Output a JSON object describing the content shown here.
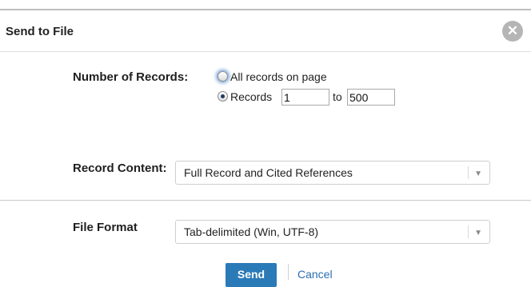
{
  "dialog": {
    "title": "Send to File",
    "close_icon": "close-icon",
    "number_of_records": {
      "label": "Number of Records:",
      "option_all": "All records on page",
      "option_range": "Records",
      "to_label": "to",
      "from_value": "1",
      "to_value": "500",
      "selected": "range"
    },
    "record_content": {
      "label": "Record Content:",
      "selected": "Full Record and Cited References"
    },
    "file_format": {
      "label": "File Format",
      "selected": "Tab-delimited (Win, UTF-8)"
    },
    "buttons": {
      "send": "Send",
      "cancel": "Cancel"
    },
    "colors": {
      "accent": "#2a7ab8",
      "link": "#2a6fb0"
    }
  }
}
